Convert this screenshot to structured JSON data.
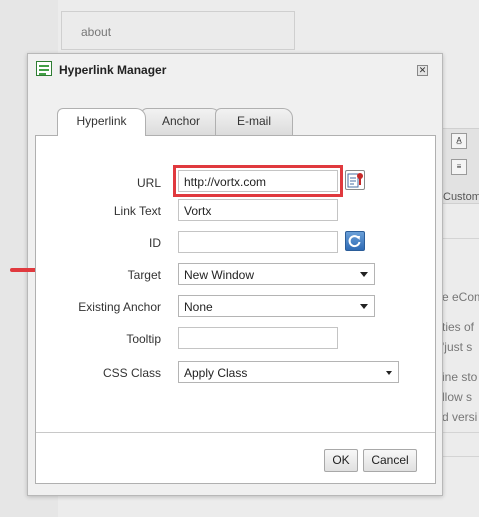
{
  "background": {
    "about_text": "about",
    "snippets": [
      "e eCom",
      "ties of",
      "'just s",
      "ine sto",
      "llow s",
      "d versi"
    ],
    "custom_text": "Custom"
  },
  "dialog": {
    "title": "Hyperlink Manager",
    "close_glyph": "✕",
    "tabs": [
      "Hyperlink",
      "Anchor",
      "E-mail"
    ],
    "active_tab": "Hyperlink",
    "fields": {
      "url": {
        "label": "URL",
        "value": "http://vortx.com"
      },
      "link_text": {
        "label": "Link Text",
        "value": "Vortx"
      },
      "id": {
        "label": "ID",
        "value": ""
      },
      "target": {
        "label": "Target",
        "value": "New Window"
      },
      "existing_anchor": {
        "label": "Existing Anchor",
        "value": "None"
      },
      "tooltip": {
        "label": "Tooltip",
        "value": ""
      },
      "css_class": {
        "label": "CSS Class",
        "value": "Apply Class"
      }
    },
    "buttons": {
      "ok": "OK",
      "cancel": "Cancel"
    }
  },
  "annotations": {
    "highlight_color": "#e0393e",
    "arrow_color": "#e0393e"
  }
}
